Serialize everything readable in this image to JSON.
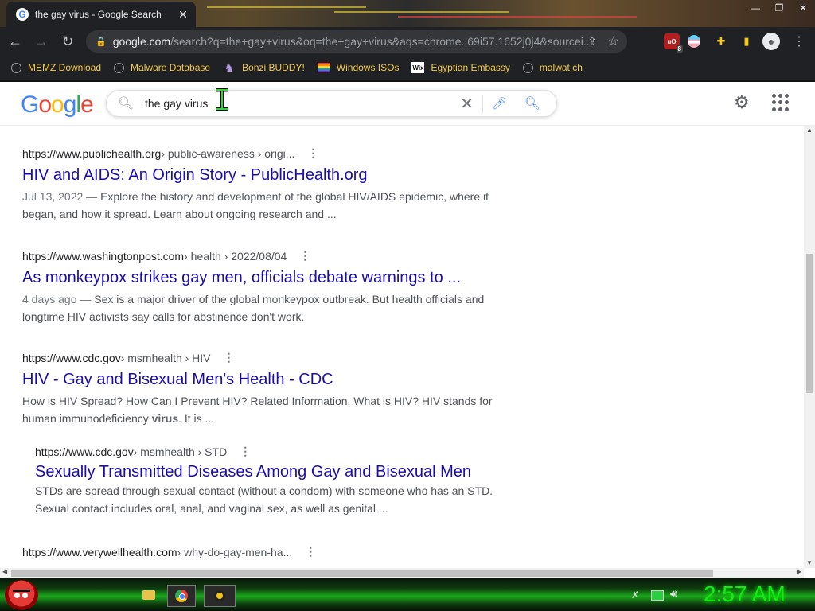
{
  "browser": {
    "tab_title": "the gay virus - Google Search",
    "tab_close": "✕",
    "url_domain": "google.com",
    "url_rest": "/search?q=the+gay+virus&oq=the+gay+virus&aqs=chrome..69i57.1652j0j4&sourcei...",
    "ublock_badge": "8",
    "bookmarks": [
      {
        "label": "MEMZ Download",
        "icon": "globe-icon"
      },
      {
        "label": "Malware Database",
        "icon": "globe-icon"
      },
      {
        "label": "Bonzi BUDDY!",
        "icon": "bonzi-icon"
      },
      {
        "label": "Windows ISOs",
        "icon": "windows-flag-icon"
      },
      {
        "label": "Egyptian Embassy",
        "icon": "wix-icon"
      },
      {
        "label": "malwat.ch",
        "icon": "globe-icon"
      }
    ]
  },
  "google": {
    "logo": [
      "G",
      "o",
      "o",
      "g",
      "l",
      "e"
    ],
    "query": "the gay virus"
  },
  "results": [
    {
      "site": "https://www.publichealth.org",
      "path": " › public-awareness › origi...",
      "title": "HIV and AIDS: An Origin Story - PublicHealth.org",
      "date": "Jul 13, 2022 — ",
      "snippet": "Explore the history and development of the global HIV/AIDS epidemic, where it began, and how it spread. Learn about ongoing research and ..."
    },
    {
      "site": "https://www.washingtonpost.com",
      "path": " › health › 2022/08/04",
      "title": "As monkeypox strikes gay men, officials debate warnings to ...",
      "date": "4 days ago — ",
      "snippet": "Sex is a major driver of the global monkeypox outbreak. But health officials and longtime HIV activists say calls for abstinence don't work."
    },
    {
      "site": "https://www.cdc.gov",
      "path": " › msmhealth › HIV",
      "title": "HIV - Gay and Bisexual Men's Health - CDC",
      "snippet_pre": "How is HIV Spread? How Can I Prevent HIV? Related Information. What is HIV? HIV stands for human immunodeficiency ",
      "snippet_bold": "virus",
      "snippet_post": ". It is ..."
    },
    {
      "site": "https://www.cdc.gov",
      "path": " › msmhealth › STD",
      "title": "Sexually Transmitted Diseases Among Gay and Bisexual Men",
      "snippet": "STDs are spread through sexual contact (without a condom) with someone who has an STD. Sexual contact includes oral, anal, and vaginal sex, as well as genital ..."
    },
    {
      "site": "https://www.verywellhealth.com",
      "path": " › why-do-gay-men-ha..."
    }
  ],
  "taskbar": {
    "clock": "2:57 AM"
  }
}
